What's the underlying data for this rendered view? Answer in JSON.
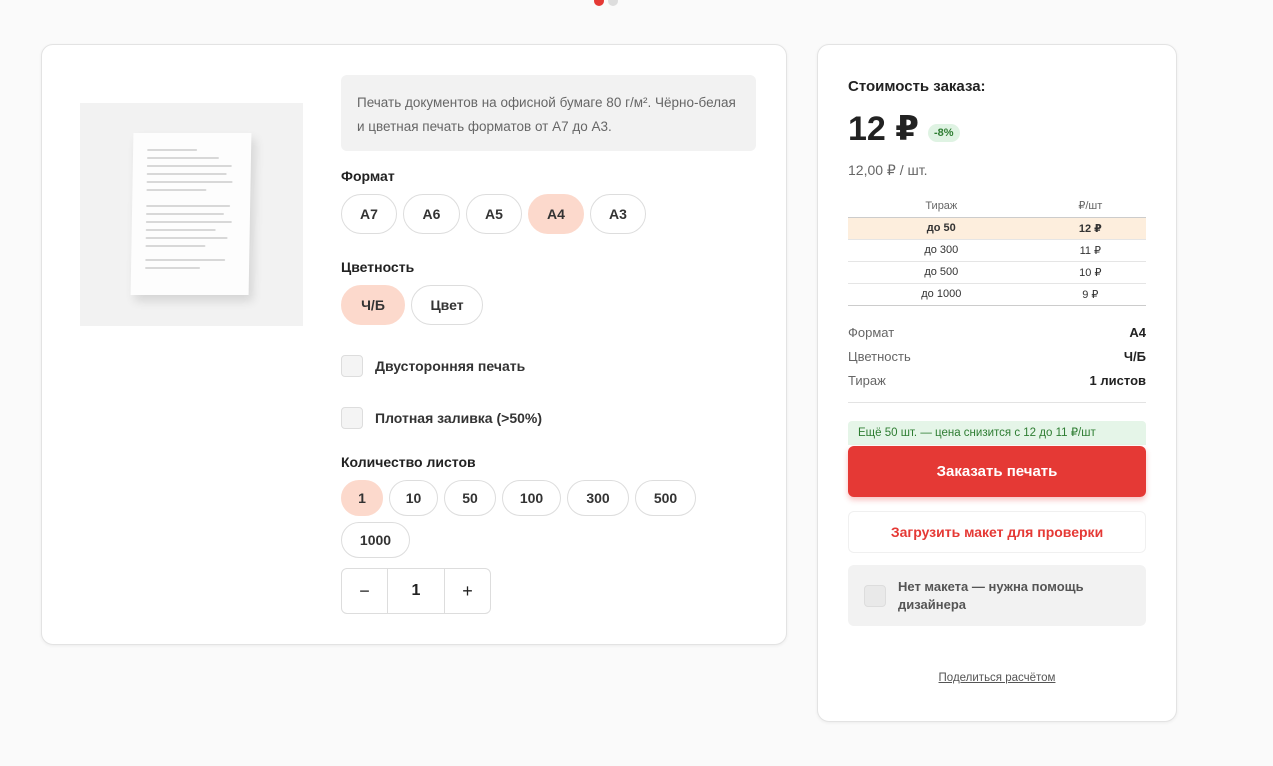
{
  "carousel": {
    "dots": 2,
    "active": 0,
    "active_color": "#e53935"
  },
  "product": {
    "image_icon": "paper-document-image",
    "description": "Печать документов на офисной бумаге 80 г/м². Чёрно-белая и цветная печать форматов от А7 до А3."
  },
  "format": {
    "label": "Формат",
    "options": [
      "А7",
      "А6",
      "А5",
      "А4",
      "А3"
    ],
    "selected": "А4"
  },
  "color": {
    "label": "Цветность",
    "options": [
      "Ч/Б",
      "Цвет"
    ],
    "selected": "Ч/Б"
  },
  "options": {
    "duplex_label": "Двусторонняя печать",
    "dense_label": "Плотная заливка (>50%)"
  },
  "quantity": {
    "label": "Количество листов",
    "presets": [
      "1",
      "10",
      "50",
      "100",
      "300",
      "500",
      "1000"
    ],
    "selected": "1",
    "stepper_minus": "−",
    "stepper_value": "1",
    "stepper_plus": "+"
  },
  "order": {
    "title": "Стоимость заказа:",
    "price": "12 ₽",
    "discount_badge": "-8%",
    "unit_price": "12,00 ₽ / шт.",
    "tier_headers": [
      "Тираж",
      "₽/шт"
    ],
    "tiers": [
      {
        "range": "до 50",
        "price": "12 ₽",
        "active": true
      },
      {
        "range": "до 300",
        "price": "11 ₽",
        "active": false
      },
      {
        "range": "до 500",
        "price": "10 ₽",
        "active": false
      },
      {
        "range": "до 1000",
        "price": "9 ₽",
        "active": false
      }
    ],
    "summary": [
      {
        "label": "Формат",
        "value": "А4"
      },
      {
        "label": "Цветность",
        "value": "Ч/Б"
      },
      {
        "label": "Тираж",
        "value": "1 листов"
      }
    ],
    "hint": "Ещё 50 шт. — цена снизится с 12 до 11 ₽/шт",
    "order_button": "Заказать печать",
    "upload_button": "Загрузить макет для проверки",
    "designer_text": "Нет макета — нужна помощь дизайнера",
    "share_link": "Поделиться расчётом"
  }
}
